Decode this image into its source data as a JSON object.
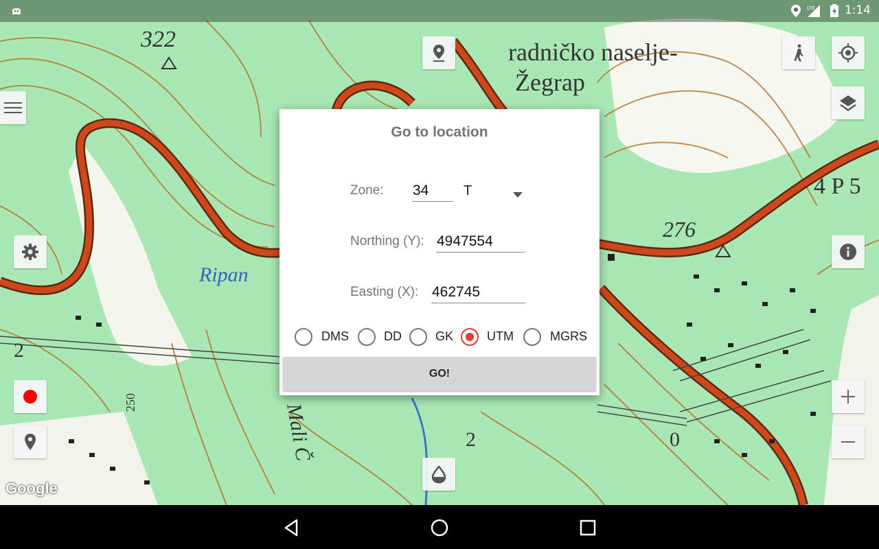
{
  "status_bar": {
    "time": "1:14",
    "network": "LTE",
    "icons": [
      "android-debug-icon",
      "location-icon",
      "signal-icon",
      "battery-icon"
    ]
  },
  "map": {
    "labels": [
      "322",
      "radničko naselje-",
      "Žegrap",
      "Ripan",
      "276",
      "4 P 5",
      "2",
      "0",
      "Mali Č",
      "250",
      "2"
    ],
    "attribution": "Google"
  },
  "dialog": {
    "title": "Go to location",
    "zone_label": "Zone:",
    "zone_value": "34",
    "zone_letter": "T",
    "northing_label": "Northing (Y):",
    "northing_value": "4947554",
    "easting_label": "Easting (X):",
    "easting_value": "462745",
    "formats": [
      {
        "label": "DMS",
        "checked": false
      },
      {
        "label": "DD",
        "checked": false
      },
      {
        "label": "GK",
        "checked": false
      },
      {
        "label": "UTM",
        "checked": true
      },
      {
        "label": "MGRS",
        "checked": false
      }
    ],
    "go_label": "GO!"
  },
  "colors": {
    "accent": "#e53935",
    "road": "#d0471c",
    "map_green": "#a9e8b4"
  }
}
